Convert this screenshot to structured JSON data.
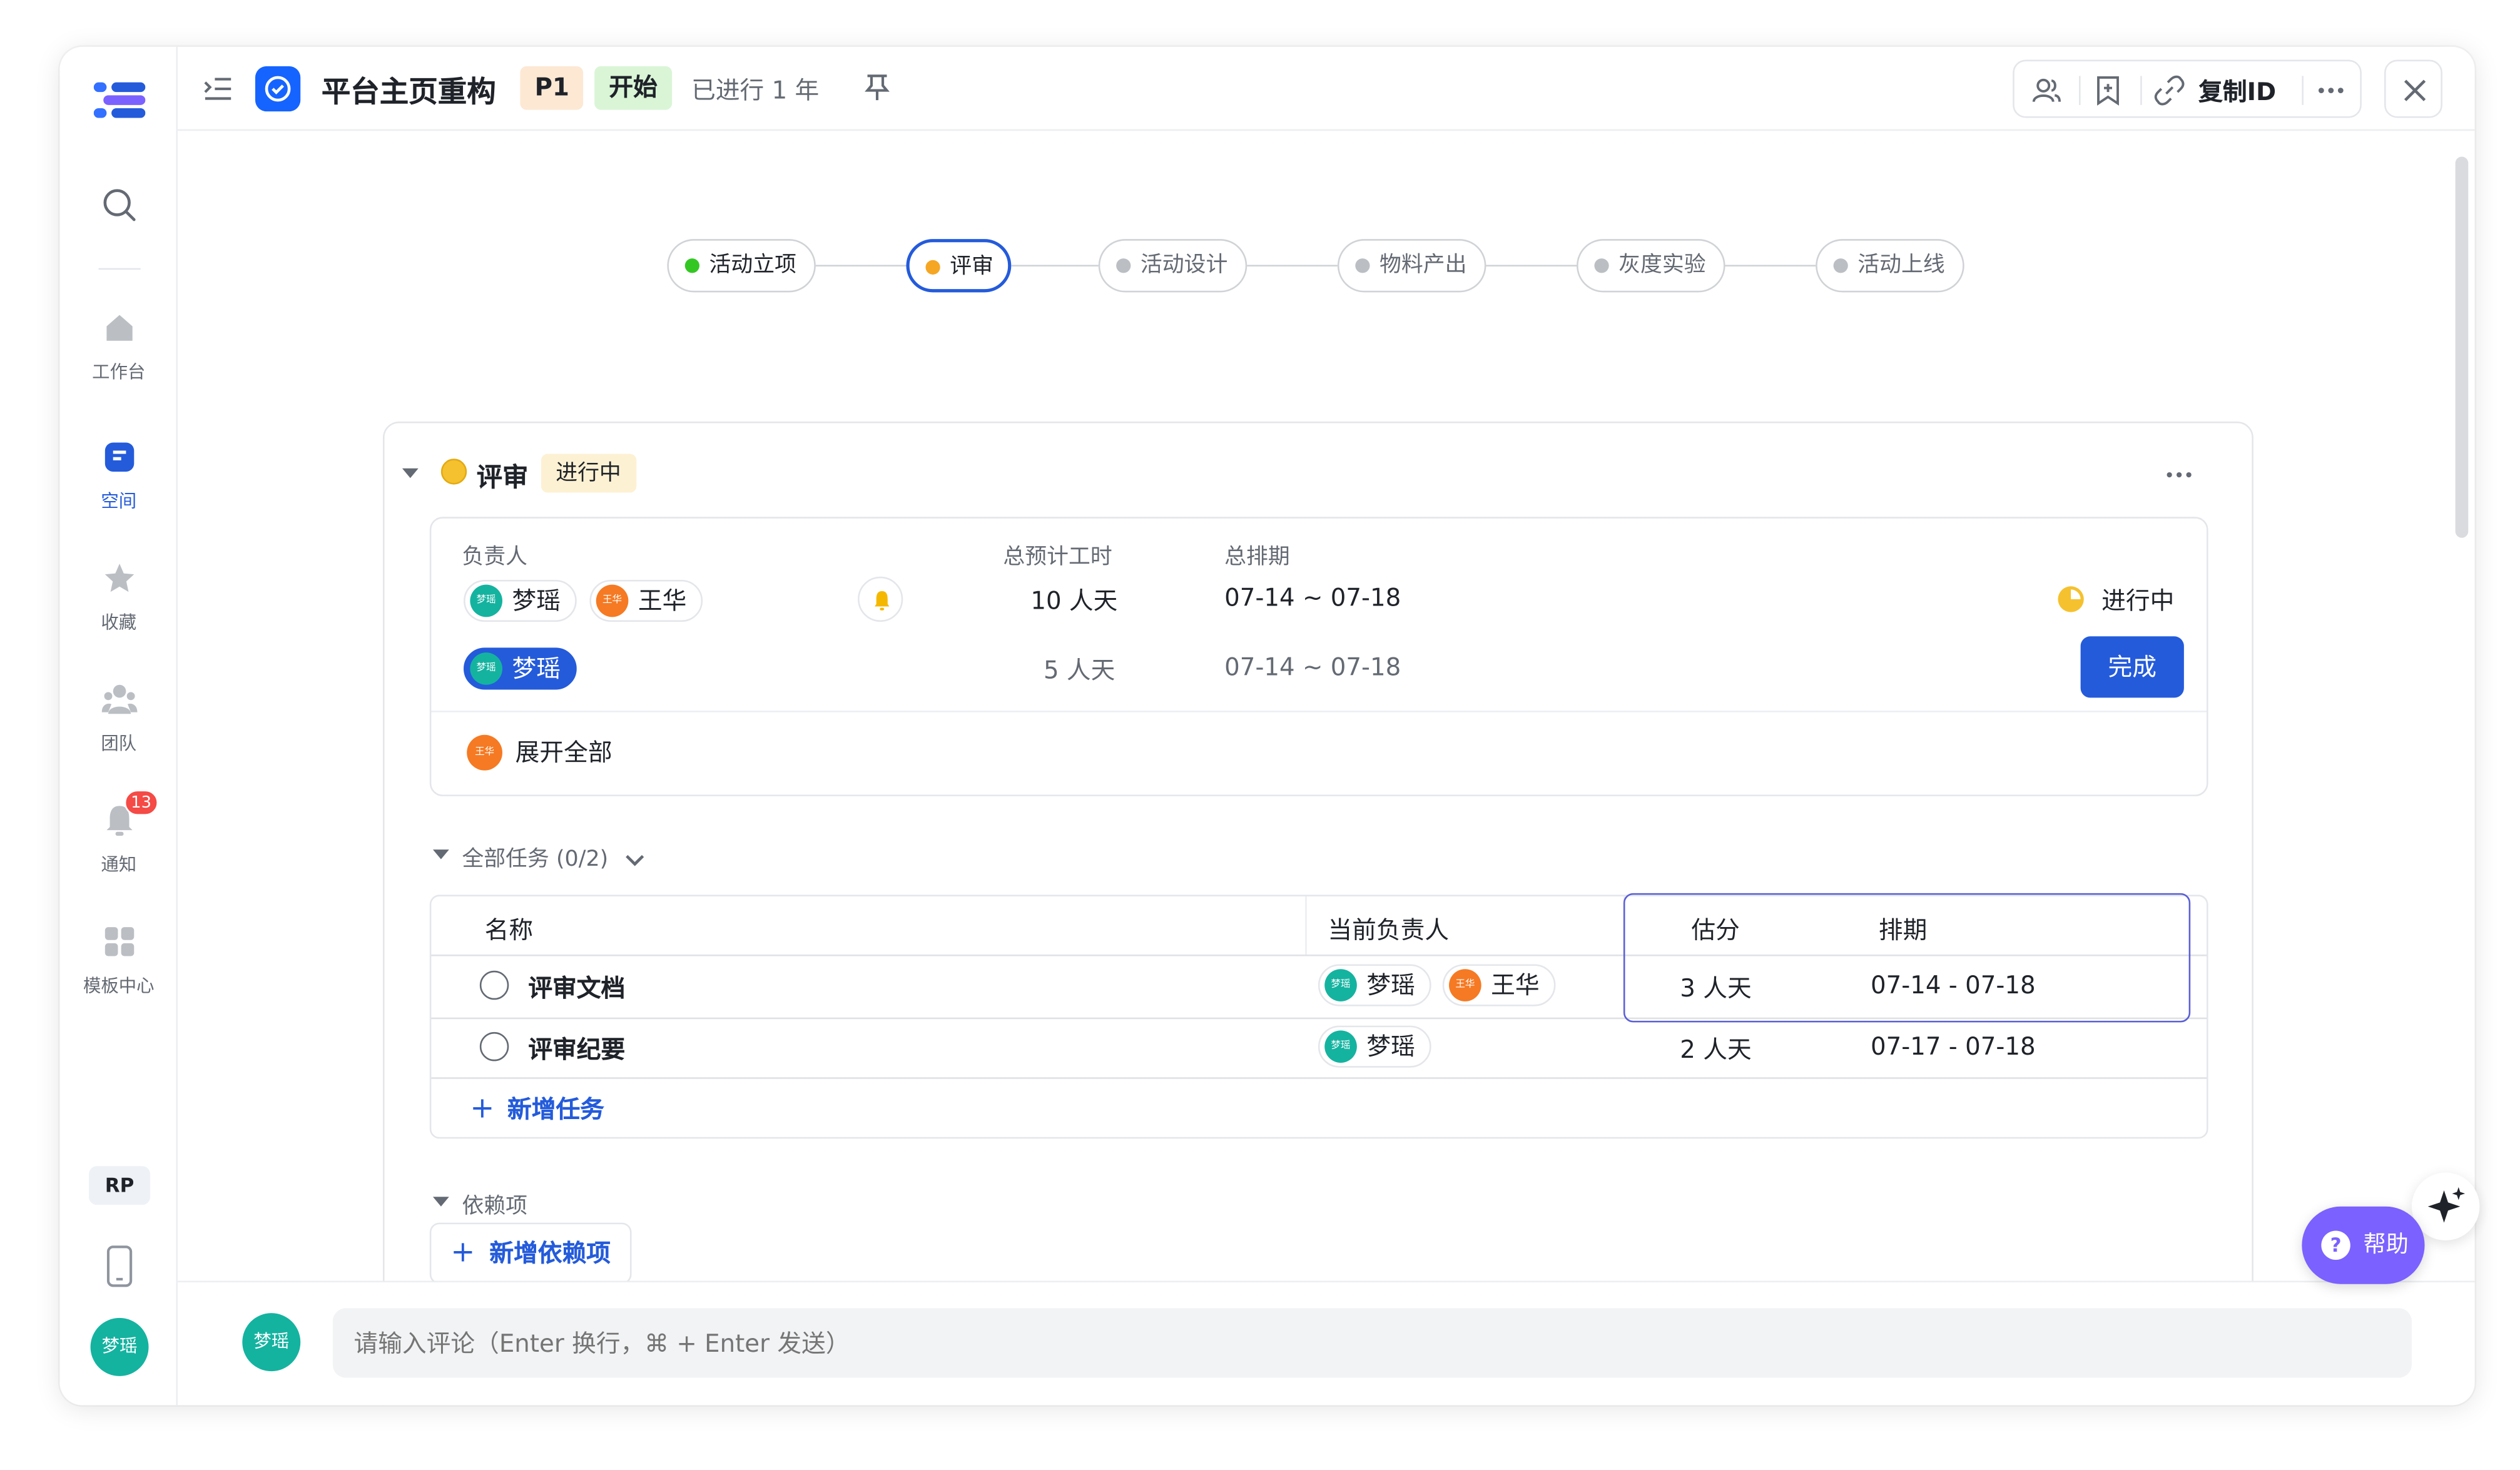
{
  "header": {
    "title": "平台主页重构",
    "priority": "P1",
    "status": "开始",
    "elapsed": "已进行 1 年",
    "copy_id": "复制ID"
  },
  "rail": {
    "items": [
      {
        "label": "工作台",
        "icon": "home-icon"
      },
      {
        "label": "空间",
        "icon": "space-icon"
      },
      {
        "label": "收藏",
        "icon": "star-icon"
      },
      {
        "label": "团队",
        "icon": "team-icon"
      },
      {
        "label": "通知",
        "icon": "bell-icon",
        "badge": "13"
      },
      {
        "label": "模板中心",
        "icon": "template-icon"
      }
    ],
    "tag": "RP",
    "avatar": "梦瑶"
  },
  "stepper": {
    "steps": [
      {
        "label": "活动立项",
        "state": "done"
      },
      {
        "label": "评审",
        "state": "current"
      },
      {
        "label": "活动设计",
        "state": "todo"
      },
      {
        "label": "物料产出",
        "state": "todo"
      },
      {
        "label": "灰度实验",
        "state": "todo"
      },
      {
        "label": "活动上线",
        "state": "todo"
      }
    ]
  },
  "stage": {
    "name": "评审",
    "status": "进行中",
    "headers": {
      "owner": "负责人",
      "estimate": "总预计工时",
      "schedule": "总排期"
    },
    "row1": {
      "owners": [
        {
          "name": "梦瑶",
          "avatar_text": "梦瑶",
          "color": "#14b3a0"
        },
        {
          "name": "王华",
          "avatar_text": "王华",
          "color": "#f57a23"
        }
      ],
      "estimate": "10 人天",
      "schedule": "07-14 ~ 07-18",
      "progress": "进行中"
    },
    "row2": {
      "owner": {
        "name": "梦瑶",
        "avatar_text": "梦瑶",
        "color": "#14b3a0"
      },
      "estimate": "5 人天",
      "schedule": "07-14 ~ 07-18",
      "action": "完成"
    },
    "expand": {
      "avatar_text": "王华",
      "label": "展开全部"
    }
  },
  "tasks": {
    "title": "全部任务 (0/2)",
    "columns": {
      "name": "名称",
      "owner": "当前负责人",
      "estimate": "估分",
      "schedule": "排期"
    },
    "rows": [
      {
        "name": "评审文档",
        "owners": [
          "梦瑶",
          "王华"
        ],
        "estimate": "3 人天",
        "schedule": "07-14 - 07-18"
      },
      {
        "name": "评审纪要",
        "owners": [
          "梦瑶"
        ],
        "estimate": "2 人天",
        "schedule": "07-17 - 07-18"
      }
    ],
    "add": "新增任务"
  },
  "dependencies": {
    "title": "依赖项",
    "add": "新增依赖项"
  },
  "comment": {
    "avatar": "梦瑶",
    "placeholder": "请输入评论（Enter 换行，⌘ + Enter 发送）"
  },
  "help": {
    "label": "帮助"
  },
  "colors": {
    "accent": "#245bdb",
    "help": "#7b61ff",
    "teal": "#14b3a0",
    "orange": "#f57a23"
  }
}
